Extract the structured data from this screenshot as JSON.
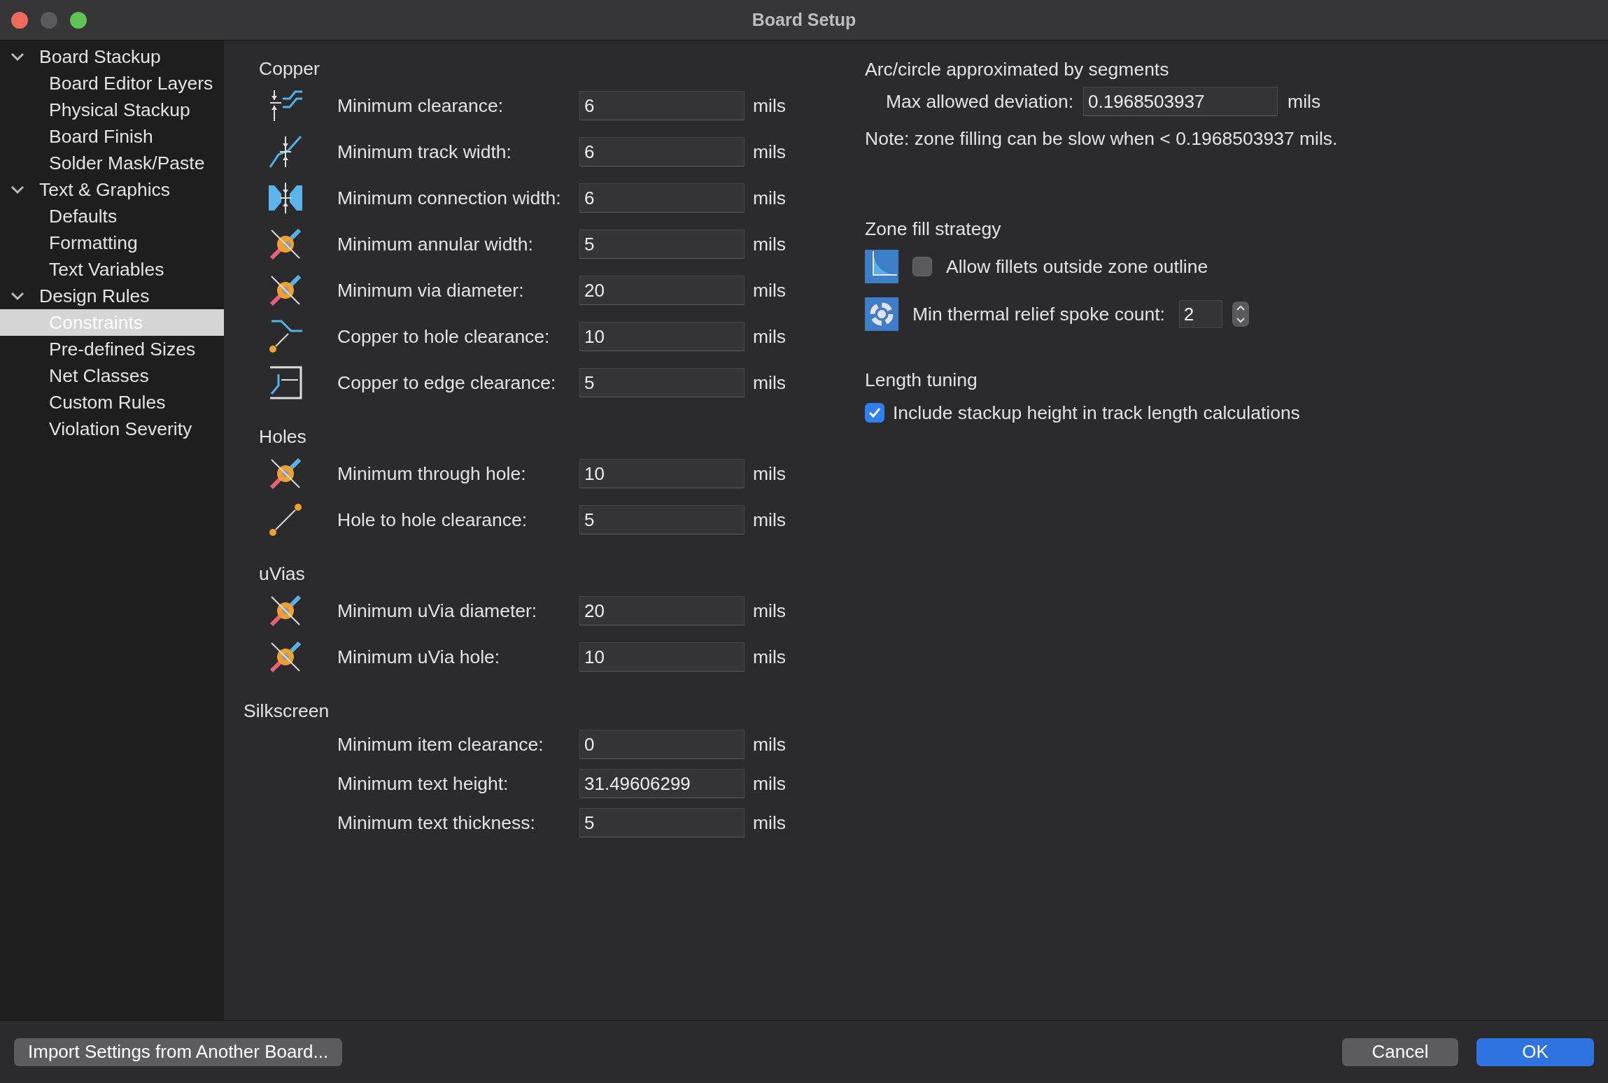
{
  "window": {
    "title": "Board Setup"
  },
  "sidebar": {
    "items": [
      {
        "label": "Board Stackup",
        "expanded": true,
        "children": [
          {
            "label": "Board Editor Layers",
            "selected": false
          },
          {
            "label": "Physical Stackup",
            "selected": false
          },
          {
            "label": "Board Finish",
            "selected": false
          },
          {
            "label": "Solder Mask/Paste",
            "selected": false
          }
        ]
      },
      {
        "label": "Text & Graphics",
        "expanded": true,
        "children": [
          {
            "label": "Defaults",
            "selected": false
          },
          {
            "label": "Formatting",
            "selected": false
          },
          {
            "label": "Text Variables",
            "selected": false
          }
        ]
      },
      {
        "label": "Design Rules",
        "expanded": true,
        "children": [
          {
            "label": "Constraints",
            "selected": true
          },
          {
            "label": "Pre-defined Sizes",
            "selected": false
          },
          {
            "label": "Net Classes",
            "selected": false
          },
          {
            "label": "Custom Rules",
            "selected": false
          },
          {
            "label": "Violation Severity",
            "selected": false
          }
        ]
      }
    ]
  },
  "sections": [
    {
      "title": "Copper",
      "rows": [
        {
          "kind": "icon",
          "label": "Minimum clearance:",
          "value": "6",
          "unit": "mils"
        },
        {
          "kind": "icon",
          "label": "Minimum track width:",
          "value": "6",
          "unit": "mils"
        },
        {
          "kind": "icon",
          "label": "Minimum connection width:",
          "value": "6",
          "unit": "mils"
        },
        {
          "kind": "icon",
          "label": "Minimum annular width:",
          "value": "5",
          "unit": "mils"
        },
        {
          "kind": "icon",
          "label": "Minimum via diameter:",
          "value": "20",
          "unit": "mils"
        },
        {
          "kind": "icon",
          "label": "Copper to hole clearance:",
          "value": "10",
          "unit": "mils"
        },
        {
          "kind": "icon",
          "label": "Copper to edge clearance:",
          "value": "5",
          "unit": "mils"
        }
      ]
    },
    {
      "title": "Holes",
      "rows": [
        {
          "kind": "icon",
          "label": "Minimum through hole:",
          "value": "10",
          "unit": "mils"
        },
        {
          "kind": "icon",
          "label": "Hole to hole clearance:",
          "value": "5",
          "unit": "mils"
        }
      ]
    },
    {
      "title": "uVias",
      "rows": [
        {
          "kind": "icon",
          "label": "Minimum uVia diameter:",
          "value": "20",
          "unit": "mils"
        },
        {
          "kind": "icon",
          "label": "Minimum uVia hole:",
          "value": "10",
          "unit": "mils"
        }
      ]
    },
    {
      "title": "Silkscreen",
      "rows": [
        {
          "kind": "plain",
          "label": "Minimum item clearance:",
          "value": "0",
          "unit": "mils"
        },
        {
          "kind": "plain",
          "label": "Minimum text height:",
          "value": "31.49606299",
          "unit": "mils"
        },
        {
          "kind": "plain",
          "label": "Minimum text thickness:",
          "value": "5",
          "unit": "mils"
        }
      ]
    }
  ],
  "arc": {
    "title": "Arc/circle approximated by segments",
    "label": "Max allowed deviation:",
    "value": "0.1968503937",
    "unit": "mils",
    "note": "Note: zone filling can be slow when < 0.1968503937 mils."
  },
  "zone_fill": {
    "title": "Zone fill strategy",
    "fillets": {
      "label": "Allow fillets outside zone outline",
      "checked": false
    },
    "spokes": {
      "label": "Min thermal relief spoke count:",
      "value": "2"
    }
  },
  "length_tuning": {
    "title": "Length tuning",
    "option": {
      "label": "Include stackup height in track length calculations",
      "checked": true
    }
  },
  "footer": {
    "import_button": "Import Settings from Another Board...",
    "buttons": [
      {
        "label": "Cancel",
        "primary": false
      },
      {
        "label": "OK",
        "primary": true
      }
    ]
  }
}
